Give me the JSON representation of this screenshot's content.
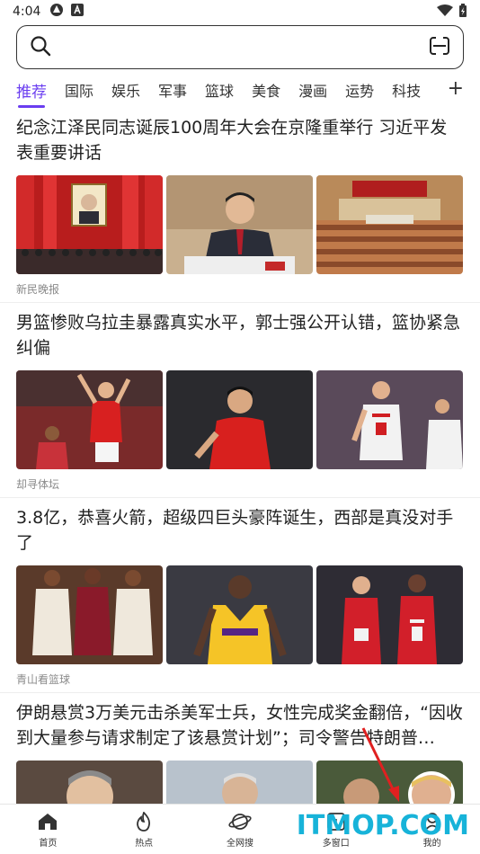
{
  "status_bar": {
    "time": "4:04"
  },
  "search": {
    "placeholder": ""
  },
  "tabs": [
    {
      "label": "推荐",
      "active": true
    },
    {
      "label": "国际"
    },
    {
      "label": "娱乐"
    },
    {
      "label": "军事"
    },
    {
      "label": "篮球"
    },
    {
      "label": "美食"
    },
    {
      "label": "漫画"
    },
    {
      "label": "运势"
    },
    {
      "label": "科技"
    }
  ],
  "tab_add": "+",
  "articles": [
    {
      "title": "纪念江泽民同志诞辰100周年大会在京隆重举行 习近平发表重要讲话",
      "source": "新民晚报"
    },
    {
      "title": "男篮惨败乌拉圭暴露真实水平，郭士强公开认错，篮协紧急纠偏",
      "source": "却寻体坛"
    },
    {
      "title": "3.8亿，恭喜火箭，超级四巨头豪阵诞生，西部是真没对手了",
      "source": "青山看篮球"
    },
    {
      "title": "伊朗悬赏3万美元击杀美军士兵，女性完成奖金翻倍，“因收到大量参与请求制定了该悬赏计划”；司令警告特朗普…",
      "source": ""
    }
  ],
  "bottom_nav": [
    {
      "label": "首页",
      "icon": "home-icon"
    },
    {
      "label": "热点",
      "icon": "flame-icon"
    },
    {
      "label": "全网搜",
      "icon": "planet-icon"
    },
    {
      "label": "多窗口",
      "icon": "windows-icon",
      "badge": "1"
    },
    {
      "label": "我的",
      "icon": "user-icon"
    }
  ],
  "watermark": "ITMOP.COM",
  "colors": {
    "accent": "#6a3df0",
    "watermark": "#17b3d9"
  }
}
